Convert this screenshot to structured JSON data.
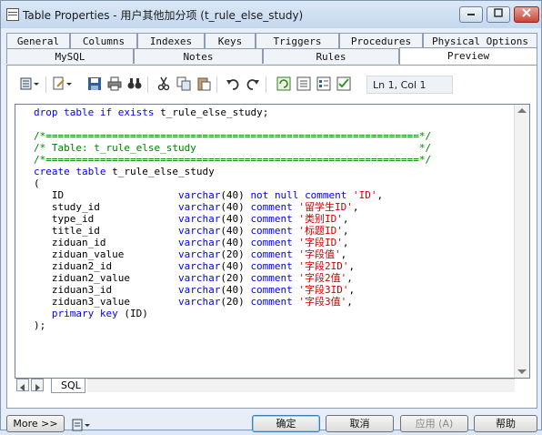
{
  "window": {
    "title": "Table Properties - 用户其他加分项 (t_rule_else_study)"
  },
  "tabs_row1": [
    "General",
    "Columns",
    "Indexes",
    "Keys",
    "Triggers",
    "Procedures",
    "Physical Options"
  ],
  "tabs_row2": [
    "MySQL",
    "Notes",
    "Rules",
    "Preview"
  ],
  "active_tab": "Preview",
  "toolbar": {
    "cursor_position": "Ln 1, Col 1"
  },
  "editor": {
    "lines": [
      "drop table if exists t_rule_else_study;",
      "",
      "/*==============================================================*/",
      "/* Table: t_rule_else_study                                     */",
      "/*==============================================================*/",
      "create table t_rule_else_study",
      "(",
      "   ID                   varchar(40) not null comment 'ID',",
      "   study_id             varchar(40) comment '留学生ID',",
      "   type_id              varchar(40) comment '类别ID',",
      "   title_id             varchar(40) comment '标题ID',",
      "   ziduan_id            varchar(40) comment '字段ID',",
      "   ziduan_value         varchar(20) comment '字段值',",
      "   ziduan2_id           varchar(40) comment '字段2ID',",
      "   ziduan2_value        varchar(20) comment '字段2值',",
      "   ziduan3_id           varchar(40) comment '字段3ID',",
      "   ziduan3_value        varchar(20) comment '字段3值',",
      "   primary key (ID)",
      ");"
    ],
    "bottom_tab": "SQL"
  },
  "buttons": {
    "more": "More >>",
    "ok": "确定",
    "cancel": "取消",
    "apply": "应用 (A)",
    "help": "帮助"
  },
  "colors": {
    "keyword": "#0000ff",
    "comment": "#008000",
    "string": "#d00000"
  }
}
